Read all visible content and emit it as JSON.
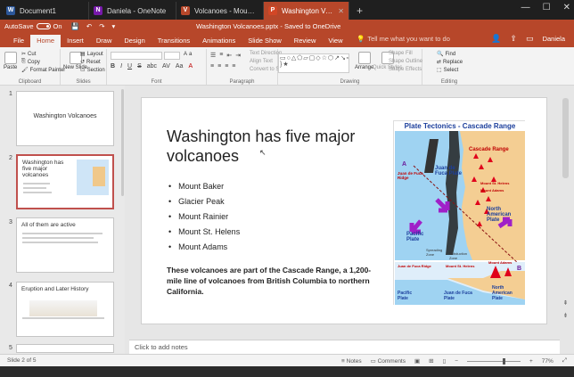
{
  "browser": {
    "tabs": [
      {
        "label": "Document1",
        "icon_letter": "W",
        "color": "#2b579a"
      },
      {
        "label": "Daniela - OneNote",
        "icon_letter": "N",
        "color": "#7719aa"
      },
      {
        "label": "Volcanoes - Mount Rainie",
        "icon_letter": "V",
        "color": "#b7472a"
      },
      {
        "label": "Washington Volcanoe",
        "icon_letter": "P",
        "color": "#d24726",
        "active": true
      }
    ],
    "new_tab": "+",
    "window_controls": [
      "—",
      "☐",
      "✕"
    ]
  },
  "titlebar": {
    "autosave_label": "AutoSave",
    "autosave_state": "On",
    "document_title": "Washington Volcanoes.pptx - Saved to OneDrive",
    "qat": [
      "💾",
      "↶",
      "↷",
      "▾"
    ],
    "user": "Daniela"
  },
  "ribbon_tabs": [
    "File",
    "Home",
    "Insert",
    "Draw",
    "Design",
    "Transitions",
    "Animations",
    "Slide Show",
    "Review",
    "View"
  ],
  "tell_me": "Tell me what you want to do",
  "ribbon": {
    "clipboard": {
      "label": "Clipboard",
      "paste": "Paste",
      "cut": "Cut",
      "copy": "Copy",
      "format_painter": "Format Painter"
    },
    "slides": {
      "label": "Slides",
      "new_slide": "New Slide",
      "layout": "Layout",
      "reset": "Reset",
      "section": "Section"
    },
    "font": {
      "label": "Font",
      "format_buttons": [
        "B",
        "I",
        "U",
        "S",
        "abc",
        "AV",
        "Aa",
        "A"
      ]
    },
    "paragraph": {
      "label": "Paragraph",
      "text_direction": "Text Direction",
      "align_text": "Align Text",
      "convert_smartart": "Convert to SmartArt"
    },
    "drawing": {
      "label": "Drawing",
      "arrange": "Arrange",
      "quick_styles": "Quick Styles",
      "shape_fill": "Shape Fill",
      "shape_outline": "Shape Outline",
      "shape_effects": "Shape Effects"
    },
    "editing": {
      "label": "Editing",
      "find": "Find",
      "replace": "Replace",
      "select": "Select"
    }
  },
  "thumbnails": [
    {
      "number": "1",
      "title": "Washington Volcanoes"
    },
    {
      "number": "2",
      "title": "Washington has five major volcanoes"
    },
    {
      "number": "3",
      "title": "All of them are active"
    },
    {
      "number": "4",
      "title": "Eruption and Later History"
    },
    {
      "number": "5",
      "title": ""
    }
  ],
  "slide": {
    "title": "Washington has five major volcanoes",
    "bullets": [
      "Mount Baker",
      "Glacier Peak",
      "Mount Rainier",
      "Mount St. Helens",
      "Mount Adams"
    ],
    "body": "These volcanoes are part of the Cascade Range, a 1,200-mile line of volcanoes from British Columbia to northern California.",
    "figure": {
      "title": "Plate Tectonics - Cascade Range",
      "labels": {
        "cascade_range": "Cascade Range",
        "juan_de_fuca_ridge": "Juan de Fuca Ridge",
        "juan_de_fuca_plate": "Juan de Fuca Plate",
        "pacific_plate": "Pacific Plate",
        "north_american_plate": "North American Plate",
        "mt_st_helens": "Mount St. Helens",
        "mt_adams": "Mount Adams",
        "spreading_zone": "Spreading Zone",
        "subduction_zone": "Subduction Zone",
        "point_a": "A",
        "point_b": "B",
        "xs_ridge": "Juan de Fuca Ridge",
        "xs_helens": "Mount St. Helens",
        "xs_adams": "Mount Adams",
        "xs_pacific": "Pacific Plate",
        "xs_jdf": "Juan de Fuca Plate",
        "xs_na": "North American Plate"
      }
    }
  },
  "notes_placeholder": "Click to add notes",
  "statusbar": {
    "slide_indicator": "Slide 2 of 5",
    "notes": "Notes",
    "comments": "Comments",
    "zoom": "77%"
  }
}
